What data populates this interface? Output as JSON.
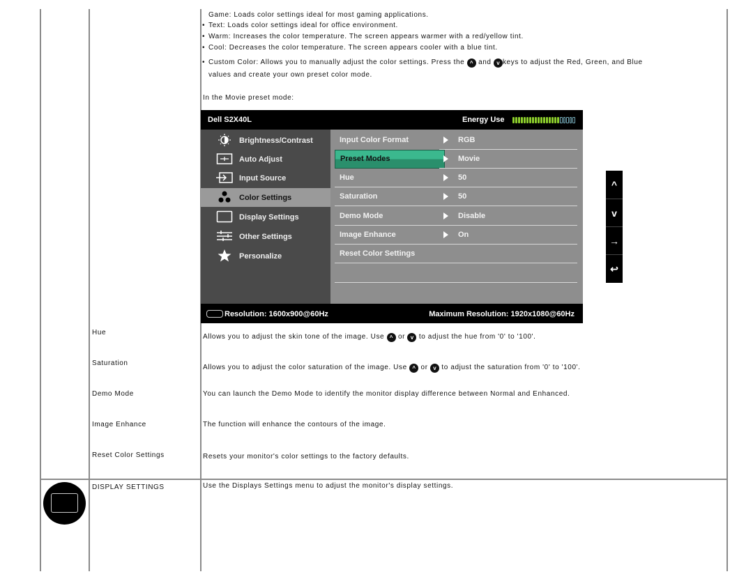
{
  "preset_descriptions": {
    "game": {
      "term": "Game",
      "text": ": Loads color settings ideal for most gaming applications."
    },
    "bullets": [
      {
        "term": "Text",
        "text": ": Loads color settings ideal for office environment."
      },
      {
        "term": "Warm",
        "text": ": Increases the color temperature. The screen appears warmer with a red/yellow tint."
      },
      {
        "term": "Cool",
        "text": ": Decreases the color temperature. The screen appears cooler with a blue tint."
      }
    ],
    "custom": {
      "term": "Custom Color",
      "text_a": ": Allows you to manually adjust the color settings. Press the",
      "and": "and",
      "text_b": "keys to adjust the Red, Green, and Blue",
      "line2": "values and create your own preset color mode."
    },
    "movie_caption": "In the Movie preset mode:"
  },
  "osd": {
    "title": "Dell S2X40L",
    "energy_label": "Energy Use",
    "energy_level": {
      "lit": 17,
      "total": 22
    },
    "menu": [
      {
        "label": "Brightness/Contrast",
        "icon": "brightness-icon",
        "active": false
      },
      {
        "label": "Auto Adjust",
        "icon": "auto-adjust-icon",
        "active": false
      },
      {
        "label": "Input Source",
        "icon": "input-source-icon",
        "active": false
      },
      {
        "label": "Color Settings",
        "icon": "color-settings-icon",
        "active": true
      },
      {
        "label": "Display Settings",
        "icon": "display-settings-icon",
        "active": false
      },
      {
        "label": "Other Settings",
        "icon": "other-settings-icon",
        "active": false
      },
      {
        "label": "Personalize",
        "icon": "star-icon",
        "active": false
      }
    ],
    "submenu": [
      {
        "label": "Input Color Format",
        "value": "RGB"
      },
      {
        "label": "Preset Modes",
        "value": "Movie",
        "selected": true
      },
      {
        "label": "Hue",
        "value": "50"
      },
      {
        "label": "Saturation",
        "value": "50"
      },
      {
        "label": "Demo Mode",
        "value": "Disable"
      },
      {
        "label": "Image Enhance",
        "value": "On"
      },
      {
        "label": "Reset Color Settings",
        "value": ""
      }
    ],
    "footer_left": "Resolution: 1600x900@60Hz",
    "footer_right": "Maximum Resolution: 1920x1080@60Hz",
    "side_buttons": [
      "up",
      "down",
      "enter",
      "back"
    ]
  },
  "rows": [
    {
      "name": "Hue",
      "desc_a": "Allows you to adjust the skin tone of the image. Use",
      "or": "or",
      "desc_b": "to adjust the hue from '0' to '100'."
    },
    {
      "name": "Saturation",
      "desc_a": "Allows you to adjust the color saturation of the image. Use",
      "or": "or",
      "desc_b": "to adjust the saturation from '0' to '100'."
    },
    {
      "name": "Demo Mode",
      "desc": "You can launch the Demo Mode to identify the monitor display difference between Normal and Enhanced."
    },
    {
      "name": "Image Enhance",
      "desc": "The function will enhance the contours of the image."
    },
    {
      "name": "Reset Color Settings",
      "desc": "Resets your monitor's color settings to the factory defaults."
    }
  ],
  "display_settings": {
    "name": "DISPLAY SETTINGS",
    "desc": "Use the Displays Settings menu to adjust the monitor's display settings."
  },
  "icons": {
    "up": "^",
    "down": "v",
    "enter": "→",
    "back": "↩"
  }
}
